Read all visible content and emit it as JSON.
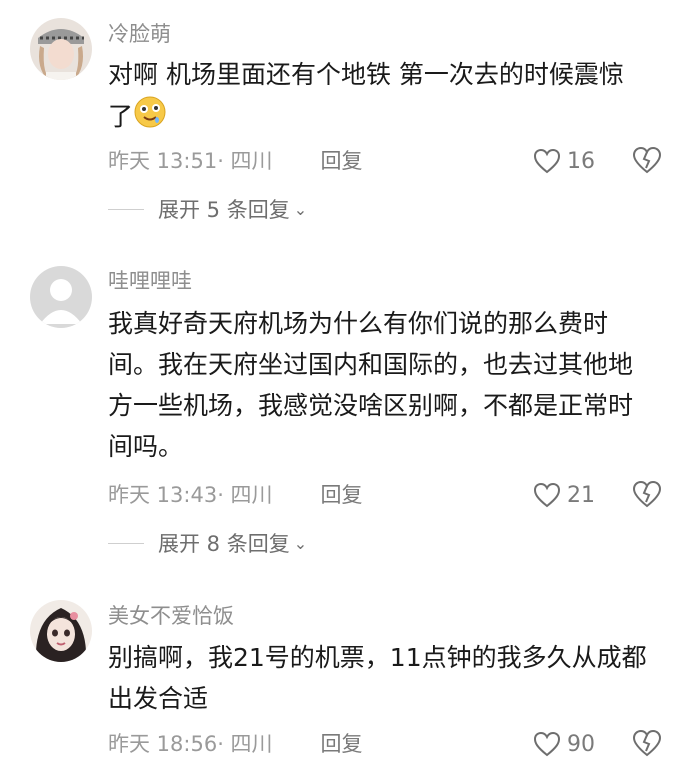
{
  "comments": [
    {
      "username": "冷脸萌",
      "text": "对啊 机场里面还有个地铁 第一次去的时候震惊\n了",
      "meta": "昨天 13:51· 四川",
      "reply_label": "回复",
      "likes": "16",
      "expand_label": "展开 5 条回复",
      "emoji_icon": "drooling-face-emoji"
    },
    {
      "username": "哇哩哩哇",
      "text": "我真好奇天府机场为什么有你们说的那么费时\n间。我在天府坐过国内和国际的，也去过其他地\n方一些机场，我感觉没啥区别啊，不都是正常时\n间吗。",
      "meta": "昨天 13:43· 四川",
      "reply_label": "回复",
      "likes": "21",
      "expand_label": "展开 8 条回复"
    },
    {
      "username": "美女不爱恰饭",
      "text": "别搞啊，我21号的机票，11点钟的我多久从成都\n出发合适",
      "meta": "昨天 18:56· 四川",
      "reply_label": "回复",
      "likes": "90"
    }
  ],
  "colors": {
    "text": "#1a1a1a",
    "muted": "#9a9a9a",
    "heart_outline": "#6e6e6e"
  }
}
